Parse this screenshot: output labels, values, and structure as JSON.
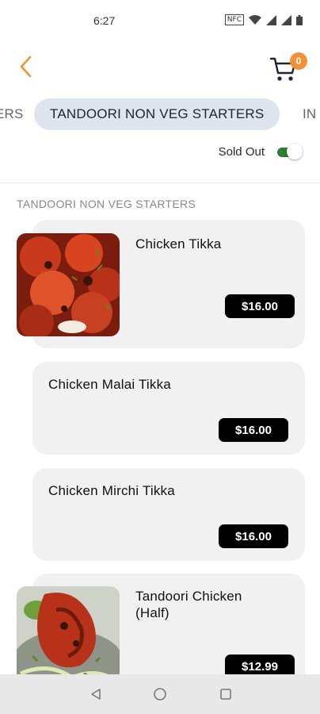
{
  "status_bar": {
    "time": "6:27",
    "nfc_label": "NFC"
  },
  "header": {
    "cart_count": "0"
  },
  "tabs": [
    {
      "label": "ERS"
    },
    {
      "label": "TANDOORI NON VEG STARTERS"
    },
    {
      "label": "IN"
    }
  ],
  "filter": {
    "sold_out_label": "Sold Out"
  },
  "section": {
    "heading": "TANDOORI NON VEG STARTERS",
    "items": [
      {
        "name": "Chicken Tikka",
        "price": "$16.00"
      },
      {
        "name": "Chicken Malai Tikka",
        "price": "$16.00"
      },
      {
        "name": "Chicken Mirchi Tikka",
        "price": "$16.00"
      },
      {
        "name": "Tandoori Chicken (Half)",
        "price": "$12.99"
      }
    ]
  },
  "colors": {
    "accent": "#f39137",
    "tab_active_bg": "#dfe5ee",
    "card_bg": "#f1f1f2",
    "price_bg": "#000000",
    "toggle_on": "#2e7d32"
  }
}
